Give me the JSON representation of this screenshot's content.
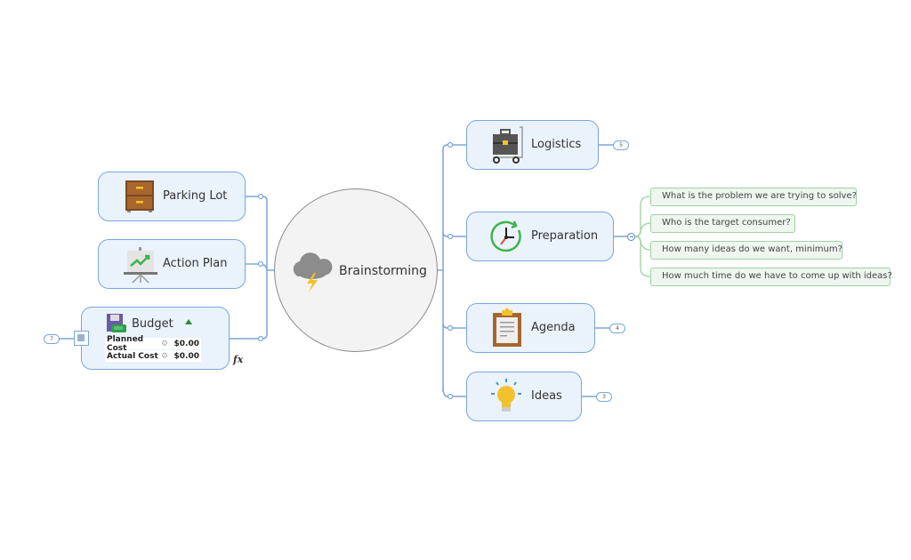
{
  "central": {
    "label": "Brainstorming",
    "icon": "storm-cloud-icon"
  },
  "left_topics": [
    {
      "label": "Parking Lot",
      "icon": "filing-cabinet-icon"
    },
    {
      "label": "Action Plan",
      "icon": "presentation-chart-icon"
    },
    {
      "label": "Budget",
      "icon": "budget-floppy-money-icon",
      "collapsed_count": "7",
      "costs": [
        {
          "name": "Planned Cost",
          "value": "$0.00"
        },
        {
          "name": "Actual Cost",
          "value": "$0.00"
        }
      ],
      "formula_marker": "fx"
    }
  ],
  "right_topics": [
    {
      "label": "Logistics",
      "icon": "briefcase-cart-icon",
      "collapsed_count": "5"
    },
    {
      "label": "Preparation",
      "icon": "clock-icon",
      "subtopics": [
        "What is the problem we are trying to solve?",
        "Who is the target consumer?",
        "How many ideas do we want, minimum?",
        "How much time do we have to come up with ideas?"
      ]
    },
    {
      "label": "Agenda",
      "icon": "clipboard-icon",
      "collapsed_count": "4"
    },
    {
      "label": "Ideas",
      "icon": "lightbulb-icon",
      "collapsed_count": "3"
    }
  ],
  "colors": {
    "branch": "#7aa6da",
    "topic_fill": "#eaf2fb",
    "subtopic_border": "#9fd1a5",
    "subtopic_fill": "#eef6ef",
    "central_fill": "#f3f3f3"
  }
}
